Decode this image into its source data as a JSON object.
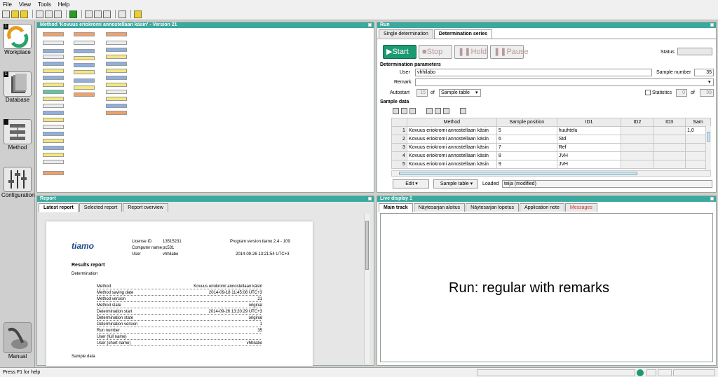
{
  "menu": [
    "File",
    "View",
    "Tools",
    "Help"
  ],
  "leftbar": {
    "items": [
      {
        "label": "Workplace",
        "badge": "1"
      },
      {
        "label": "Database",
        "badge": "1"
      },
      {
        "label": "Method",
        "badge": ""
      },
      {
        "label": "Configuration",
        "badge": ""
      },
      {
        "label": "Manual",
        "badge": ""
      }
    ]
  },
  "method_panel": {
    "title": "Method 'Kovuus eriokromi annostellaan käsin' - Version 21"
  },
  "run_panel": {
    "title": "Run",
    "tabs": [
      "Single determination",
      "Determination series"
    ],
    "buttons": {
      "start": "Start",
      "stop": "Stop",
      "hold": "Hold",
      "pause": "Pause"
    },
    "status_label": "Status",
    "status_value": "",
    "det_params_label": "Determination parameters",
    "user_label": "User",
    "user_value": "vhhilabo",
    "sample_number_label": "Sample number",
    "sample_number_value": "35",
    "remark_label": "Remark",
    "remark_value": "",
    "autostart_label": "Autostart",
    "autostart_value": "15",
    "of_label": "of",
    "autostart_source": "Sample table",
    "statistics_label": "Statistics",
    "statistics_value": "0",
    "statistics_of_label": "of",
    "statistics_total": "99",
    "sample_data_label": "Sample data",
    "columns": [
      "Method",
      "Sample position",
      "ID1",
      "ID2",
      "ID3",
      "Sam"
    ],
    "rows": [
      {
        "n": "1",
        "method": "Kovuus eriokromi annostellaan käsin",
        "pos": "5",
        "id1": "huuhtelu",
        "id2": "",
        "id3": "",
        "sam": "1,0"
      },
      {
        "n": "2",
        "method": "Kovuus eriokromi annostellaan käsin",
        "pos": "6",
        "id1": "Std",
        "id2": "",
        "id3": "",
        "sam": ""
      },
      {
        "n": "3",
        "method": "Kovuus eriokromi annostellaan käsin",
        "pos": "7",
        "id1": "Ref",
        "id2": "",
        "id3": "",
        "sam": ""
      },
      {
        "n": "4",
        "method": "Kovuus eriokromi annostellaan käsin",
        "pos": "8",
        "id1": "JVH",
        "id2": "",
        "id3": "",
        "sam": ""
      },
      {
        "n": "5",
        "method": "Kovuus eriokromi annostellaan käsin",
        "pos": "9",
        "id1": "JVH",
        "id2": "",
        "id3": "",
        "sam": ""
      }
    ],
    "edit_button": "Edit",
    "sample_table_button": "Sample table",
    "loaded_label": "Loaded",
    "loaded_value": "teija (modified)"
  },
  "report_panel": {
    "title": "Report",
    "tabs": [
      "Latest report",
      "Selected report",
      "Report overview"
    ],
    "logo": "tiamo",
    "license_label": "License ID",
    "license_value": "13515231",
    "program_version": "Program version tiamo 2.4 - 109",
    "computer_label": "Computer name",
    "computer_value": "pc531",
    "user_label": "User",
    "user_value": "vhhilabo",
    "datetime": "2014-09-26  13:21:54 UTC+3",
    "results_title": "Results report",
    "determination_label": "Determination",
    "fields": [
      {
        "label": "Method",
        "value": "Kovuus eriokromi annostellaan käsin"
      },
      {
        "label": "Method saving date",
        "value": "2014-09-18 11:45:08 UTC+3"
      },
      {
        "label": "Method version",
        "value": "21"
      },
      {
        "label": "Method state",
        "value": "original"
      },
      {
        "label": "Determination start",
        "value": "2014-09-26 13:20:29 UTC+3"
      },
      {
        "label": "Determination state",
        "value": "original"
      },
      {
        "label": "Determination version",
        "value": "1"
      },
      {
        "label": "Run number",
        "value": "35"
      },
      {
        "label": "User (full name)",
        "value": ""
      },
      {
        "label": "User (short name)",
        "value": "vhhilabo"
      }
    ],
    "sample_data_label": "Sample data"
  },
  "live_panel": {
    "title": "Live display 1",
    "tabs": [
      "Main track",
      "Näytesarjan aloitus",
      "Näytesarjan lopetus",
      "Application note",
      "Messages"
    ],
    "message": "Run: regular with remarks"
  },
  "statusbar": {
    "help": "Press F1 for help"
  },
  "colors": {
    "accent": "#3aa9a0",
    "start": "#1c9a72",
    "messages_tab": "#cc3333"
  }
}
